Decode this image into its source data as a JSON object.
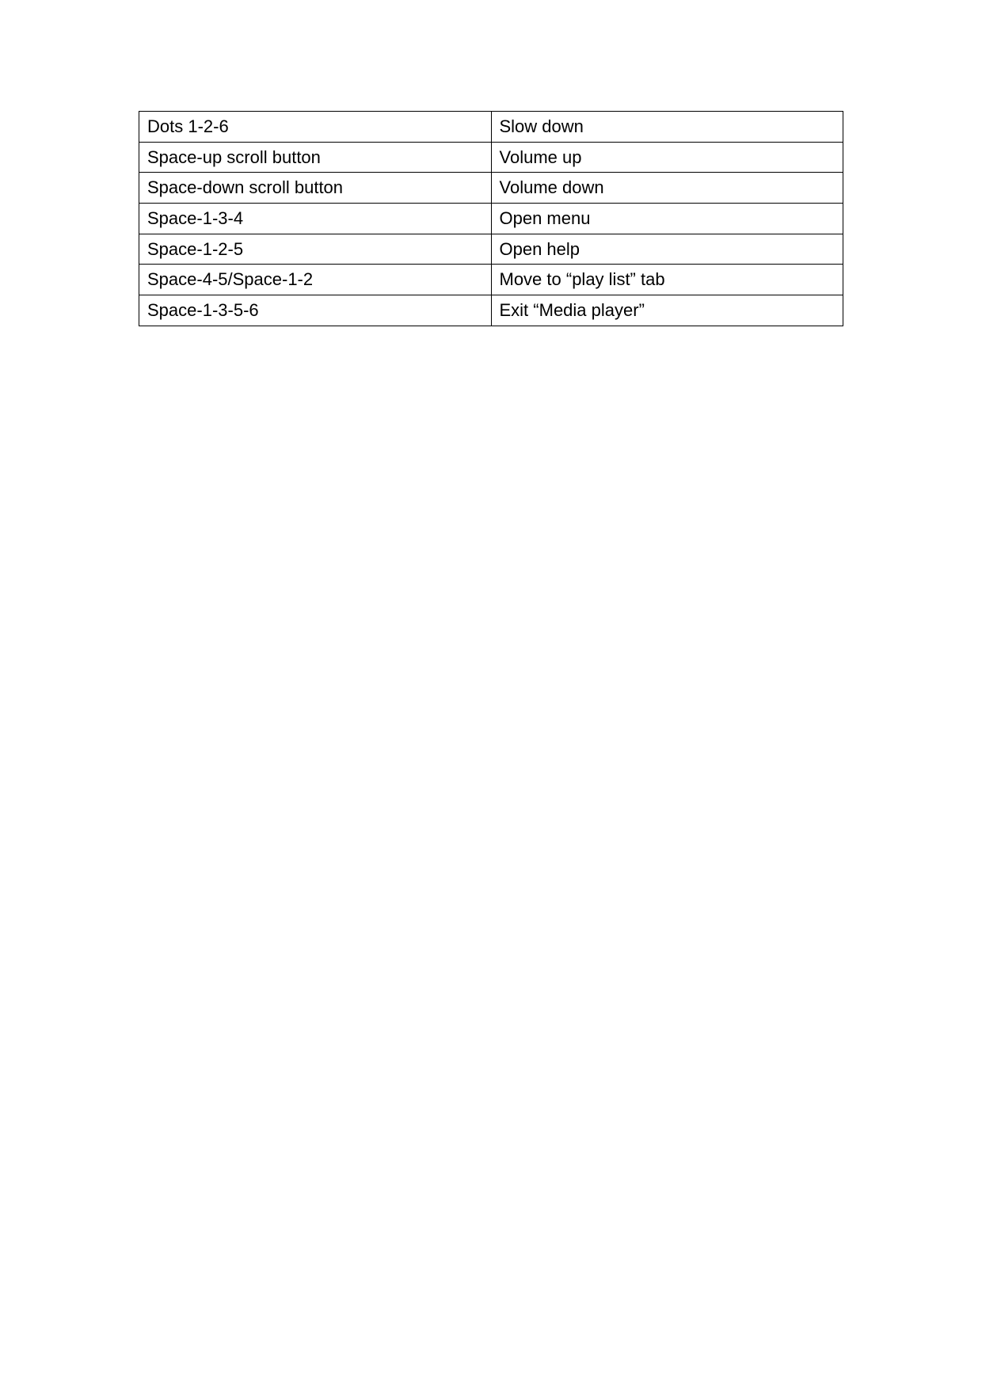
{
  "table": {
    "rows": [
      {
        "key": "Dots 1-2-6",
        "action": "Slow down"
      },
      {
        "key": "Space-up scroll button",
        "action": "Volume up"
      },
      {
        "key": "Space-down scroll button",
        "action": "Volume down"
      },
      {
        "key": "Space-1-3-4",
        "action": "Open menu"
      },
      {
        "key": "Space-1-2-5",
        "action": "Open help"
      },
      {
        "key": "Space-4-5/Space-1-2",
        "action": "Move to “play list” tab"
      },
      {
        "key": "Space-1-3-5-6",
        "action": "Exit “Media player”"
      }
    ]
  }
}
